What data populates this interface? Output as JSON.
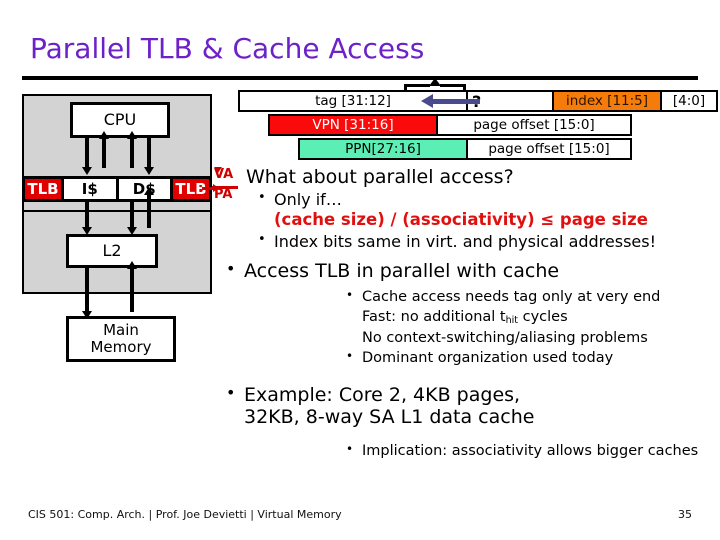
{
  "slide": {
    "title": "Parallel TLB & Cache Access",
    "title_color": "#6D21C8",
    "page_number": "35",
    "footer": "CIS 501: Comp. Arch.  |  Prof. Joe Devietti  |  Virtual Memory"
  },
  "diagram": {
    "cpu": "CPU",
    "tlb_left": "TLB",
    "icache": "I$",
    "dcache": "D$",
    "tlb_right": "TLB",
    "l2": "L2",
    "main_memory_line1": "Main",
    "main_memory_line2": "Memory",
    "va_label": "VA",
    "pa_label": "PA",
    "colors": {
      "chip_fill": "#D3D3D3",
      "tlb_fill": "#E00000",
      "va_pa": "#D00000"
    }
  },
  "address_table": {
    "rows": [
      {
        "name": "physical-address-row",
        "cells": [
          {
            "text": "tag [31:12]",
            "color": "#FFFFFF"
          },
          {
            "text": "?",
            "color": "#FFFFFF"
          },
          {
            "text": "index [11:5]",
            "color": "#F57C0A"
          },
          {
            "text": "[4:0]",
            "color": "#FFFFFF"
          }
        ]
      },
      {
        "name": "virtual-address-row",
        "cells": [
          {
            "text": "VPN [31:16]",
            "color": "#FA0A0A"
          },
          {
            "text": "page offset [15:0]",
            "color": "#FFFFFF"
          }
        ]
      },
      {
        "name": "translated-address-row",
        "cells": [
          {
            "text": "PPN[27:16]",
            "color": "#5BEFB5"
          },
          {
            "text": "page offset [15:0]",
            "color": "#FFFFFF"
          }
        ]
      }
    ],
    "arrow_color": "#4A4A8C"
  },
  "body": {
    "heading": "What about parallel access?",
    "only_if": "Only if…",
    "condition": "(cache size) / (associativity) ≤ page size",
    "index_bits": "Index bits same in virt. and physical addresses!",
    "access_tlb": "Access TLB in parallel with cache",
    "sub_points": [
      {
        "marker": "bullet",
        "text_pre": "Cache access needs tag only at very end",
        "sub": "",
        "text_post": ""
      },
      {
        "marker": "plus",
        "text_pre": "Fast: no additional t",
        "sub": "hit",
        "text_post": " cycles"
      },
      {
        "marker": "plus",
        "text_pre": "No context-switching/aliasing problems",
        "sub": "",
        "text_post": ""
      },
      {
        "marker": "bullet",
        "text_pre": "Dominant organization used today",
        "sub": "",
        "text_post": ""
      }
    ],
    "example_line1": "Example: Core 2, 4KB pages,",
    "example_line2": "32KB, 8-way SA L1 data cache",
    "implication": "Implication: associativity allows bigger caches"
  }
}
